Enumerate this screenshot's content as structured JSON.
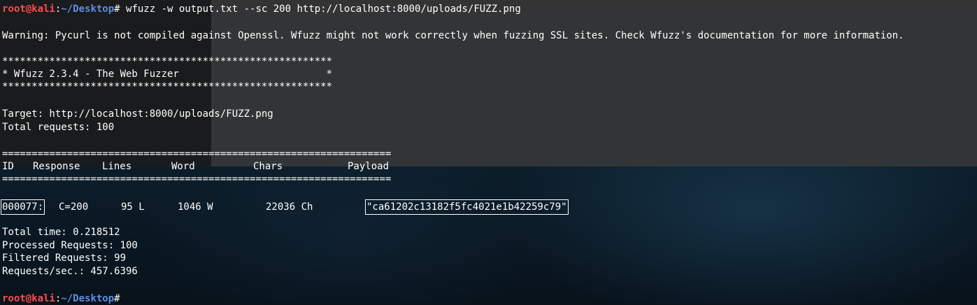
{
  "prompt": {
    "user_host": "root@kali",
    "separator": ":",
    "path": "~/Desktop",
    "symbol": "#"
  },
  "command": " wfuzz -w output.txt --sc 200 http://localhost:8000/uploads/FUZZ.png",
  "warning": "Warning: Pycurl is not compiled against Openssl. Wfuzz might not work correctly when fuzzing SSL sites. Check Wfuzz's documentation for more information.",
  "banner": {
    "border": "********************************************************",
    "title": "* Wfuzz 2.3.4 - The Web Fuzzer                         *"
  },
  "target": "Target: http://localhost:8000/uploads/FUZZ.png",
  "total_requests": "Total requests: 100",
  "separator_line": "==================================================================",
  "table": {
    "headers": [
      "ID",
      "Response",
      "Lines",
      "Word",
      "Chars",
      "Payload"
    ],
    "row": {
      "id": "000077:",
      "response": "C=200",
      "lines": "95 L",
      "word": "1046 W",
      "chars": "22036 Ch",
      "payload": "\"ca61202c13182f5fc4021e1b42259c79\""
    }
  },
  "summary": {
    "total_time": "Total time: 0.218512",
    "processed": "Processed Requests: 100",
    "filtered": "Filtered Requests: 99",
    "rate": "Requests/sec.: 457.6396"
  }
}
